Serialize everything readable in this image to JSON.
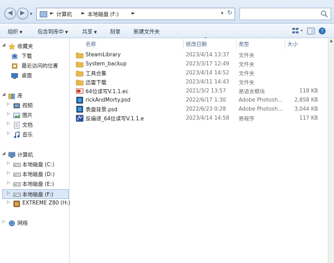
{
  "address": {
    "crumbs": [
      "计算机",
      "本地磁盘 (F:)"
    ],
    "separator": "►"
  },
  "toolbar": {
    "organize": "组织",
    "include_in_library": "包含到库中",
    "share": "共享",
    "burn": "刻录",
    "new_folder": "新建文件夹"
  },
  "nav": {
    "favorites": "收藏夹",
    "downloads": "下载",
    "recent": "最近访问的位置",
    "desktop": "桌面",
    "libraries": "库",
    "videos": "视频",
    "pictures": "图片",
    "documents": "文档",
    "music": "音乐",
    "computer": "计算机",
    "drive_c": "本地磁盘 (C:)",
    "drive_d": "本地磁盘 (D:)",
    "drive_e": "本地磁盘 (E:)",
    "drive_f": "本地磁盘 (F:)",
    "drive_h": "EXTREME Z80 (H:)",
    "network": "网络"
  },
  "columns": {
    "name": "名称",
    "date": "修改日期",
    "type": "类型",
    "size": "大小",
    "sort_indicator": "^"
  },
  "files": [
    {
      "name": "SteamLibrary",
      "date": "2023/4/14 13:37",
      "type": "文件夹",
      "size": "",
      "icon": "folder-icon"
    },
    {
      "name": "System_backup",
      "date": "2023/3/17 12:49",
      "type": "文件夹",
      "size": "",
      "icon": "folder-icon"
    },
    {
      "name": "工具合集",
      "date": "2023/4/14 14:52",
      "type": "文件夹",
      "size": "",
      "icon": "folder-icon"
    },
    {
      "name": "迅雷下载",
      "date": "2023/4/11 14:43",
      "type": "文件夹",
      "size": "",
      "icon": "folder-icon"
    },
    {
      "name": "64位读写V.1.1.ec",
      "date": "2021/3/2 13:57",
      "type": "易语言模块",
      "size": "118 KB",
      "icon": "ec-module-icon"
    },
    {
      "name": "rickAndMorty.psd",
      "date": "2022/6/17 1:30",
      "type": "Adobe Photosh...",
      "size": "2,858 KB",
      "icon": "psd-icon"
    },
    {
      "name": "表盘背景.psd",
      "date": "2022/6/23 0:28",
      "type": "Adobe Photosh...",
      "size": "3,044 KB",
      "icon": "psd-icon"
    },
    {
      "name": "反编译_64位读写V.1.1.e",
      "date": "2023/4/14 14:58",
      "type": "易程序",
      "size": "117 KB",
      "icon": "e-program-icon"
    }
  ],
  "colors": {
    "folder": "#e8b84a",
    "selection": "#dae8f7",
    "header_text": "#4d6185"
  }
}
